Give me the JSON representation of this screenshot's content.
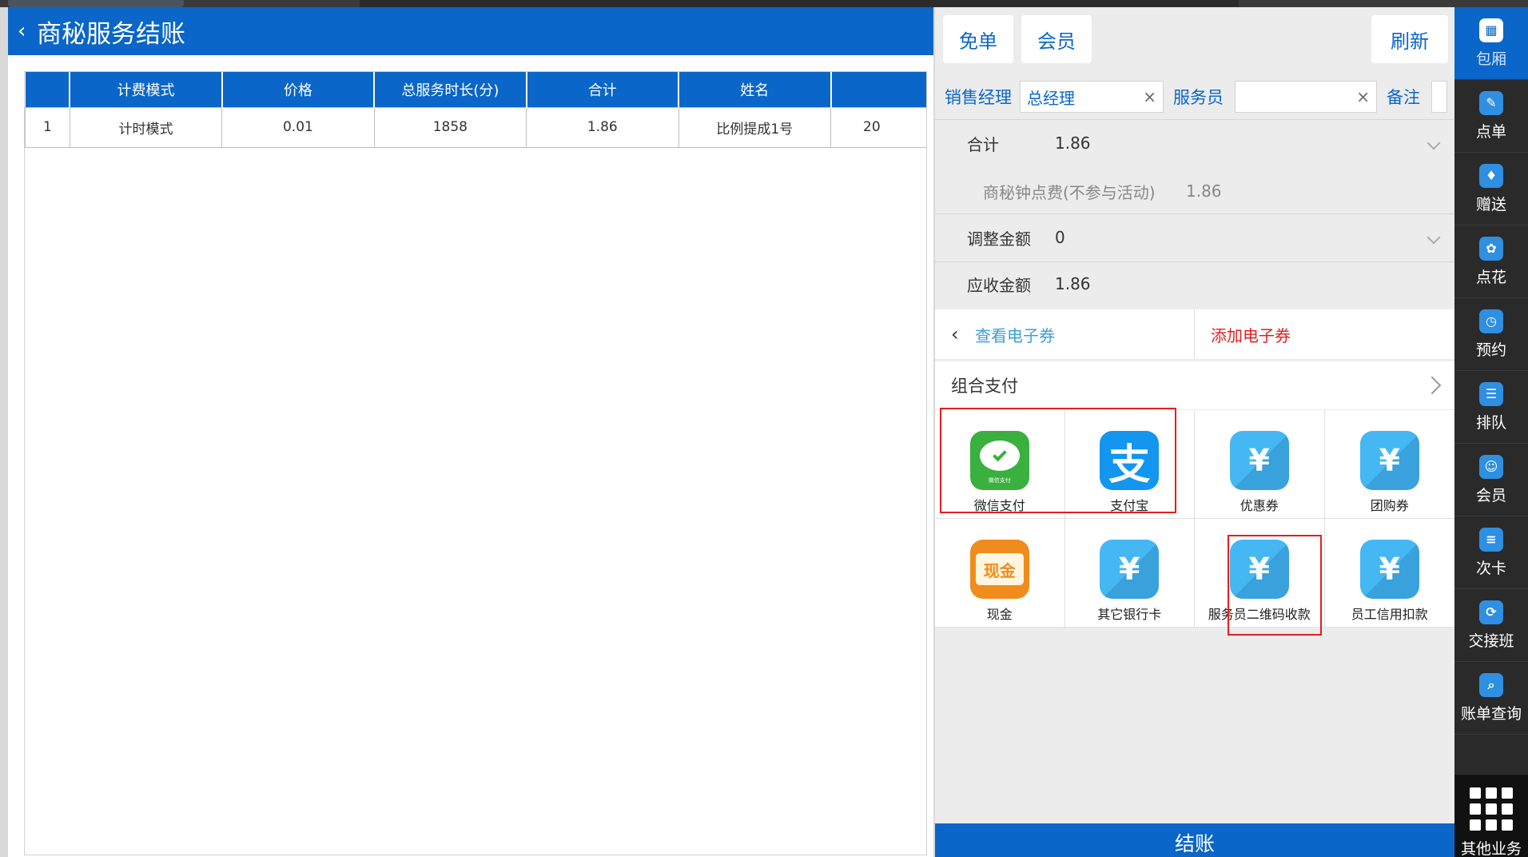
{
  "page": {
    "title": "商秘服务结账",
    "back_icon": "chevron-left-icon"
  },
  "table": {
    "columns": [
      "",
      "计费模式",
      "价格",
      "总服务时长(分)",
      "合计",
      "姓名",
      ""
    ],
    "rows": [
      [
        "1",
        "计时模式",
        "0.01",
        "1858",
        "1.86",
        "比例提成1号",
        "20"
      ]
    ]
  },
  "right": {
    "free_label": "免单",
    "member_label": "会员",
    "refresh_label": "刷新",
    "sales_manager_label": "销售经理",
    "sales_manager_value": "总经理",
    "waiter_label": "服务员",
    "waiter_value": "",
    "remark_label": "备注",
    "clear_icon": "×",
    "total_label": "合计",
    "total_value": "1.86",
    "detail_label": "商秘钟点费(不参与活动)",
    "detail_value": "1.86",
    "adjust_label": "调整金额",
    "adjust_value": "0",
    "due_label": "应收金额",
    "due_value": "1.86",
    "view_voucher_label": "查看电子券",
    "add_voucher_label": "添加电子券",
    "combo_pay_label": "组合支付",
    "payments": [
      {
        "label": "微信支付",
        "icon": "wechat-pay-icon",
        "icon_text": "微信支付"
      },
      {
        "label": "支付宝",
        "icon": "alipay-icon",
        "icon_text": "支"
      },
      {
        "label": "优惠券",
        "icon": "coupon-yen-icon",
        "icon_text": "¥"
      },
      {
        "label": "团购券",
        "icon": "group-buy-yen-icon",
        "icon_text": "¥"
      },
      {
        "label": "现金",
        "icon": "cash-icon",
        "icon_text": "现金"
      },
      {
        "label": "其它银行卡",
        "icon": "bank-card-yen-icon",
        "icon_text": "¥"
      },
      {
        "label": "服务员二维码收款",
        "icon": "waiter-qr-yen-icon",
        "icon_text": "¥"
      },
      {
        "label": "员工信用扣款",
        "icon": "staff-credit-yen-icon",
        "icon_text": "¥"
      }
    ],
    "checkout_label": "结账"
  },
  "sidebar": {
    "items": [
      {
        "label": "包厢",
        "icon": "rooms-icon",
        "glyph": "▦"
      },
      {
        "label": "点单",
        "icon": "order-icon",
        "glyph": "✎"
      },
      {
        "label": "赠送",
        "icon": "gift-icon",
        "glyph": "♦"
      },
      {
        "label": "点花",
        "icon": "flower-icon",
        "glyph": "✿"
      },
      {
        "label": "预约",
        "icon": "reservation-icon",
        "glyph": "◷"
      },
      {
        "label": "排队",
        "icon": "queue-icon",
        "glyph": "☰"
      },
      {
        "label": "会员",
        "icon": "member-icon",
        "glyph": "☺"
      },
      {
        "label": "次卡",
        "icon": "count-card-icon",
        "glyph": "≡"
      },
      {
        "label": "交接班",
        "icon": "shift-icon",
        "glyph": "⟳"
      },
      {
        "label": "账单查询",
        "icon": "bill-query-icon",
        "glyph": "⌕"
      }
    ],
    "more_label": "其他业务",
    "more_icon": "grid-menu-icon"
  },
  "colors": {
    "brand_blue": "#0a66c8",
    "highlight_red": "#e02020",
    "add_voucher_red": "#e02020",
    "view_voucher_teal": "#3aa0d8"
  }
}
